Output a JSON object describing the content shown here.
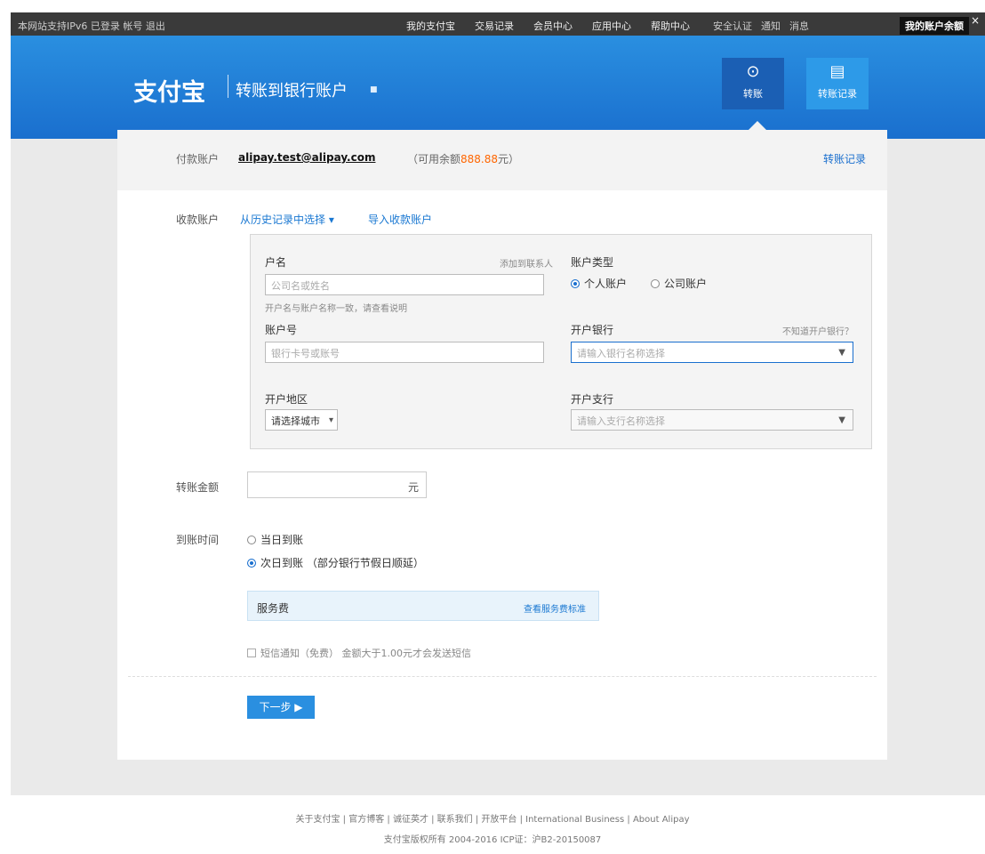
{
  "topbar": {
    "left": "本网站支持IPv6 已登录 帐号 退出",
    "nav": [
      "我的支付宝",
      "交易记录",
      "会员中心",
      "应用中心",
      "帮助中心"
    ],
    "right": [
      "安全认证",
      "通知",
      "消息"
    ],
    "badge": "我的账户余额",
    "close": "×"
  },
  "header": {
    "logo": "支付宝",
    "title": "转账到银行账户",
    "title_arrow": "■",
    "buttons": [
      {
        "label": "转账",
        "icon": "transfer-icon"
      },
      {
        "label": "转账记录",
        "icon": "record-icon"
      }
    ]
  },
  "account": {
    "label": "付款账户",
    "email": "alipay.test@alipay.com",
    "balance_prefix": "（可用余额",
    "balance": "888.88",
    "balance_suffix": "元）",
    "records_link": "转账记录"
  },
  "payee": {
    "label": "收款账户",
    "select_link": "从历史记录中选择 ▾",
    "new_link": "导入收款账户"
  },
  "form": {
    "name_label": "户名",
    "name_hint_right": "添加到联系人",
    "name_placeholder": "公司名或姓名",
    "name_help": "开户名与账户名称一致，请查看说明",
    "acct_type_label": "账户类型",
    "acct_types": [
      "个人账户",
      "公司账户"
    ],
    "acct_no_label": "账户号",
    "acct_no_placeholder": "银行卡号或账号",
    "bank_label": "开户银行",
    "bank_help": "不知道开户银行？",
    "bank_placeholder": "请输入银行名称选择",
    "region_label": "开户地区",
    "region_value": "请选择城市",
    "branch_label": "开户支行",
    "branch_placeholder": "请输入支行名称选择"
  },
  "amount": {
    "label": "转账金额",
    "unit": "元"
  },
  "arrival": {
    "label": "到账时间",
    "options": [
      "当日到账",
      "次日到账 （部分银行节假日顺延）"
    ]
  },
  "fee": {
    "title": "服务费",
    "link": "查看服务费标准"
  },
  "notify": {
    "text": "短信通知（免费） 金额大于1.00元才会发送短信"
  },
  "next_button": "下一步 ▶",
  "footer": {
    "links": "关于支付宝 | 官方博客 | 诚征英才 | 联系我们 | 开放平台 | International Business | About Alipay",
    "copyright": "支付宝版权所有 2004-2016 ICP证：沪B2-20150087"
  }
}
